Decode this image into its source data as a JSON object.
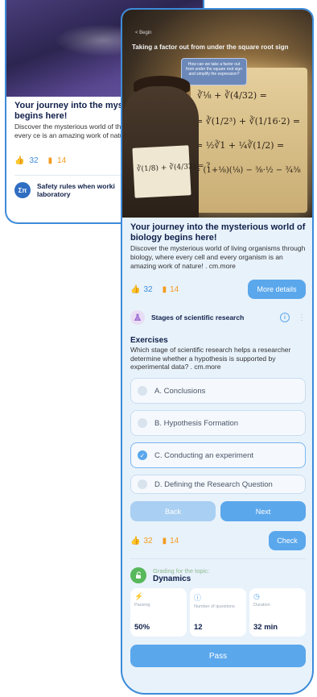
{
  "back_card": {
    "title": "Your journey into the myste biology begins here!",
    "desc": "Discover the mysterious world of through biology, where every ce is an amazing work of nature! . c",
    "likes": "32",
    "bookmarks": "14",
    "next_item_icon": "calculator-icon",
    "next_item_label": "Safety rules when worki laboratory"
  },
  "hero": {
    "back_label": "< Begin",
    "title": "Taking a factor out from under the square root sign",
    "speech": "How can we take a factor out from under the square root sign and simplify the expression?",
    "eq1": "∛⅛ + ∛(4/32) =",
    "eq2": "= ∛(1/2³) + ∛(1/16·2) =",
    "eq3": "= ½∛1 + ¼∛(1/2) =",
    "eq4": "= (1+⅛)(⅛) − ⅜·½ − ¾⅜",
    "paper_eq": "∛(1/8) + ∛(4/32) = ?"
  },
  "post": {
    "title": "Your journey into the mysterious world of biology begins here!",
    "desc": "Discover the mysterious world of living organisms through biology, where every cell and every organism is an amazing work of nature! . cm.more",
    "likes": "32",
    "bookmarks": "14",
    "more_btn": "More details"
  },
  "topic": {
    "name": "Stages of scientific research",
    "info_icon": "info-icon",
    "menu": "⋮"
  },
  "exercise": {
    "heading": "Exercises",
    "question": "Which stage of scientific research helps a researcher determine whether a hypothesis is supported by experimental data? . cm.more",
    "options": [
      {
        "label": "A. Conclusions",
        "checked": false
      },
      {
        "label": "B. Hypothesis Formation",
        "checked": false
      },
      {
        "label": "C. Conducting an experiment",
        "checked": true
      },
      {
        "label": "D. Defining the Research Question",
        "checked": false
      }
    ],
    "back_btn": "Back",
    "next_btn": "Next"
  },
  "stats2": {
    "likes": "32",
    "bookmarks": "14",
    "check_btn": "Check"
  },
  "grading": {
    "subtitle": "Grading for the topic:",
    "topic": "Dynamics",
    "cards": [
      {
        "icon": "trend-icon",
        "label": "Passing",
        "value": "50%"
      },
      {
        "icon": "question-icon",
        "label": "Number of questions",
        "value": "12"
      },
      {
        "icon": "clock-icon",
        "label": "Duration",
        "value": "32 min"
      }
    ],
    "pass_btn": "Pass"
  },
  "colors": {
    "accent": "#5aa7ec",
    "border": "#3d8bd9",
    "bookmark": "#f59b1c",
    "success": "#57b85c",
    "navy": "#10204a"
  }
}
